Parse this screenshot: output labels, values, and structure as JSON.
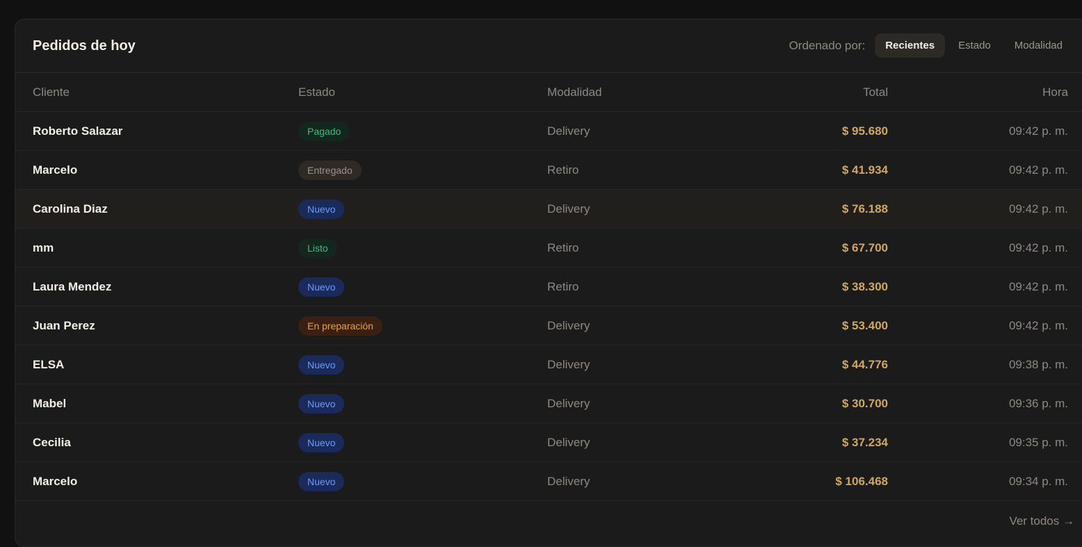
{
  "header": {
    "title": "Pedidos de hoy",
    "sort_label": "Ordenado por:",
    "sort_options": [
      "Recientes",
      "Estado",
      "Modalidad"
    ],
    "sort_active": "Recientes"
  },
  "table": {
    "columns": [
      "Cliente",
      "Estado",
      "Modalidad",
      "Total",
      "Hora"
    ],
    "rows": [
      {
        "cliente": "Roberto Salazar",
        "estado": "Pagado",
        "estado_tipo": "pagado",
        "modalidad": "Delivery",
        "total": "$ 95.680",
        "hora": "09:42 p. m."
      },
      {
        "cliente": "Marcelo",
        "estado": "Entregado",
        "estado_tipo": "entregado",
        "modalidad": "Retiro",
        "total": "$ 41.934",
        "hora": "09:42 p. m."
      },
      {
        "cliente": "Carolina Diaz",
        "estado": "Nuevo",
        "estado_tipo": "nuevo",
        "modalidad": "Delivery",
        "total": "$ 76.188",
        "hora": "09:42 p. m."
      },
      {
        "cliente": "mm",
        "estado": "Listo",
        "estado_tipo": "listo",
        "modalidad": "Retiro",
        "total": "$ 67.700",
        "hora": "09:42 p. m."
      },
      {
        "cliente": "Laura Mendez",
        "estado": "Nuevo",
        "estado_tipo": "nuevo",
        "modalidad": "Retiro",
        "total": "$ 38.300",
        "hora": "09:42 p. m."
      },
      {
        "cliente": "Juan Perez",
        "estado": "En preparación",
        "estado_tipo": "preparacion",
        "modalidad": "Delivery",
        "total": "$ 53.400",
        "hora": "09:42 p. m."
      },
      {
        "cliente": "ELSA",
        "estado": "Nuevo",
        "estado_tipo": "nuevo",
        "modalidad": "Delivery",
        "total": "$ 44.776",
        "hora": "09:38 p. m."
      },
      {
        "cliente": "Mabel",
        "estado": "Nuevo",
        "estado_tipo": "nuevo",
        "modalidad": "Delivery",
        "total": "$ 30.700",
        "hora": "09:36 p. m."
      },
      {
        "cliente": "Cecilia",
        "estado": "Nuevo",
        "estado_tipo": "nuevo",
        "modalidad": "Delivery",
        "total": "$ 37.234",
        "hora": "09:35 p. m."
      },
      {
        "cliente": "Marcelo",
        "estado": "Nuevo",
        "estado_tipo": "nuevo",
        "modalidad": "Delivery",
        "total": "$ 106.468",
        "hora": "09:34 p. m."
      }
    ]
  },
  "footer": {
    "ver_todos": "Ver todos →"
  },
  "colors": {
    "background": "#111111",
    "panel": "#1b1b1b",
    "total_accent": "#d1a863",
    "nuevo": "#6b9cff",
    "pagado": "#35c27c",
    "preparacion": "#f0a030"
  }
}
